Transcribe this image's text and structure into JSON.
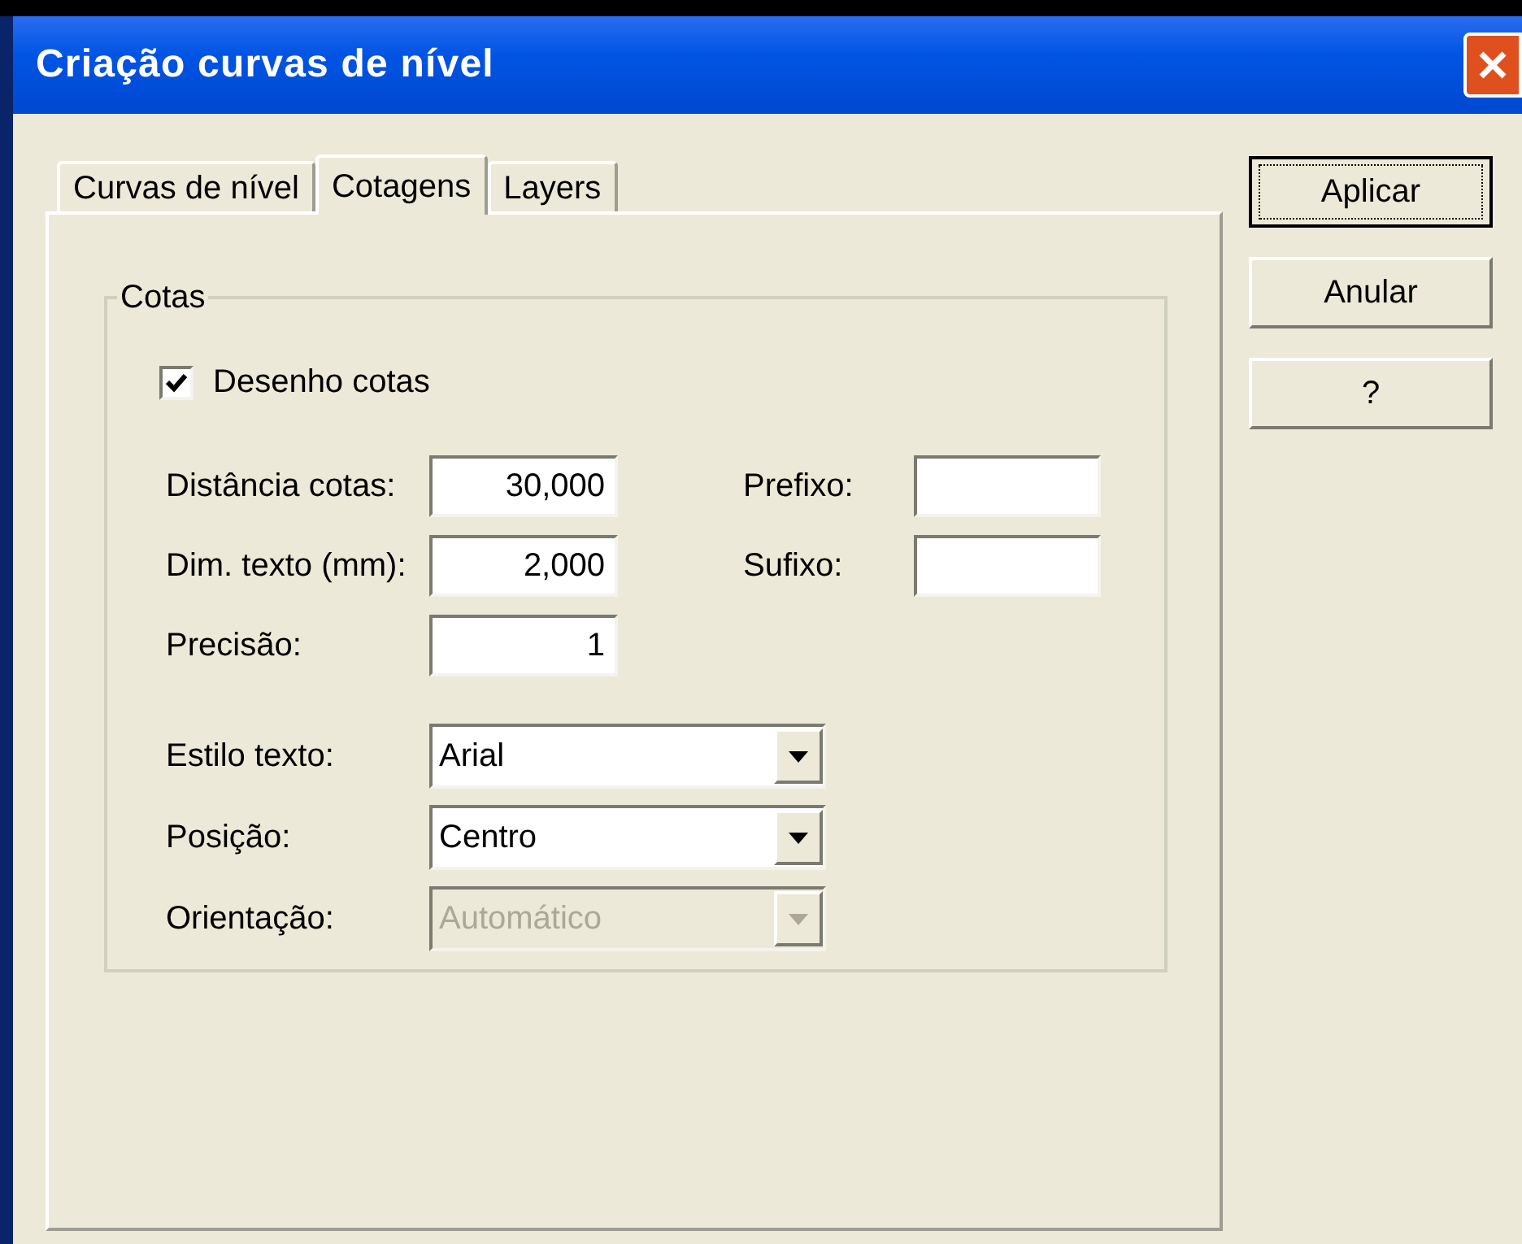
{
  "window": {
    "title": "Criação curvas de nível"
  },
  "tabs": [
    {
      "label": "Curvas de nível",
      "selected": false
    },
    {
      "label": "Cotagens",
      "selected": true
    },
    {
      "label": "Layers",
      "selected": false
    }
  ],
  "group": {
    "title": "Cotas",
    "checkbox": {
      "label": "Desenho cotas",
      "checked": true
    },
    "fields": [
      {
        "label": "Distância cotas:",
        "value": "30,000",
        "side": {
          "label": "Prefixo:"
        }
      },
      {
        "label": "Dim. texto (mm):",
        "value": "2,000",
        "side": {
          "label": "Sufixo:"
        }
      },
      {
        "label": "Precisão:",
        "value": "1"
      }
    ],
    "dropdowns": [
      {
        "label": "Estilo texto:",
        "value": "Arial",
        "disabled": false
      },
      {
        "label": "Posição:",
        "value": "Centro",
        "disabled": false
      },
      {
        "label": "Orientação:",
        "value": "Automático",
        "disabled": true
      }
    ]
  },
  "buttons": [
    {
      "label": "Aplicar",
      "default": true
    },
    {
      "label": "Anular",
      "default": false
    },
    {
      "label": "?",
      "default": false
    }
  ]
}
